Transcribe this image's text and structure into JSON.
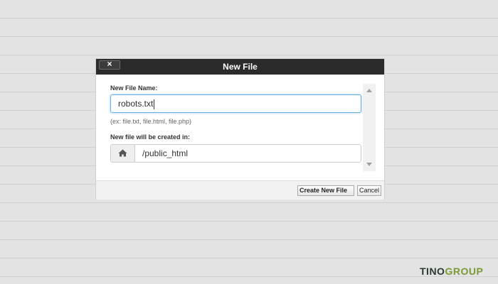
{
  "dialog": {
    "title": "New File",
    "close_symbol": "×",
    "file_name_label": "New File Name:",
    "file_name_value": "robots.txt",
    "file_name_hint": "(ex: file.txt, file.html, file.php)",
    "location_label": "New file will be created in:",
    "location_value": "/public_html",
    "location_icon": "home-icon",
    "create_button": "Create New File",
    "cancel_button": "Cancel"
  },
  "watermark": {
    "part1": "TINO",
    "part2": "GROUP",
    "colors": {
      "part1": "#2b3a2f",
      "part2": "#7a9a35"
    }
  },
  "colors": {
    "titlebar": "#2b2b2b",
    "focus_border": "#66afe9",
    "background": "#e3e3e3"
  }
}
